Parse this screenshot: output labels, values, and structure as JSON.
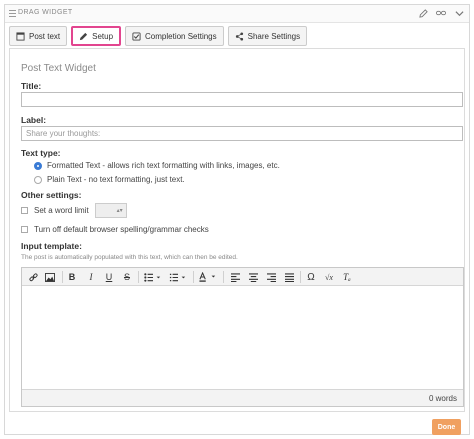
{
  "widget": {
    "title": "DRAG WIDGET",
    "tools": [
      "edit-icon",
      "link-icon",
      "collapse-icon"
    ]
  },
  "tabs": [
    {
      "label": "Post text",
      "icon": "post-icon",
      "active": false
    },
    {
      "label": "Setup",
      "icon": "pencil-icon",
      "active": true
    },
    {
      "label": "Completion Settings",
      "icon": "checkbox-icon",
      "active": false
    },
    {
      "label": "Share Settings",
      "icon": "share-icon",
      "active": false
    }
  ],
  "setup": {
    "section_title": "Post Text Widget",
    "title_label": "Title:",
    "title_value": "",
    "label_label": "Label:",
    "label_placeholder": "Share your thoughts:",
    "text_type_label": "Text type:",
    "text_types": [
      {
        "label": "Formatted Text - allows rich text formatting with links, images, etc.",
        "selected": true
      },
      {
        "label": "Plain Text - no text formatting, just text.",
        "selected": false
      }
    ],
    "other_settings_label": "Other settings:",
    "word_limit_label": "Set a word limit",
    "word_limit_checked": false,
    "spellcheck_label": "Turn off default browser spelling/grammar checks",
    "spellcheck_checked": false,
    "input_template_label": "Input template:",
    "input_template_hint": "The post is automatically populated with this text, which can then be edited.",
    "word_count": "0 words"
  },
  "editor_toolbar": [
    "link-icon",
    "image-icon",
    "bold-icon",
    "italic-icon",
    "underline-icon",
    "strikethrough-icon",
    "bullet-list-icon",
    "numbered-list-icon",
    "font-color-icon",
    "align-left-icon",
    "align-center-icon",
    "align-right-icon",
    "align-justify-icon",
    "omega-icon",
    "formula-icon",
    "clear-format-icon"
  ],
  "footer": {
    "done_label": "Done"
  },
  "colors": {
    "active_tab_border": "#e2458f",
    "radio_selected": "#3a7bd5",
    "done_button": "#f0a060"
  }
}
